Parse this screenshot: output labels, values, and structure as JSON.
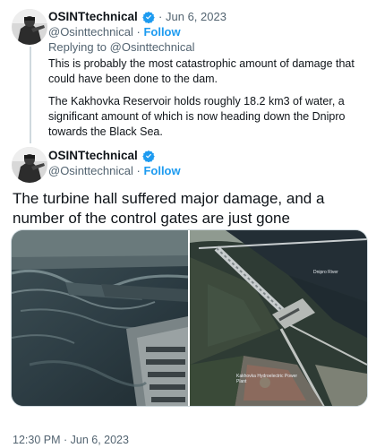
{
  "first_tweet": {
    "display_name": "OSINTtechnical",
    "separator": "·",
    "date": "Jun 6, 2023",
    "handle": "@Osinttechnical",
    "follow_label": "Follow",
    "replying_prefix": "Replying to",
    "replying_handle": "@Osinttechnical",
    "paragraph_1": "This is probably the most catastrophic amount of damage that could have been done to the dam.",
    "paragraph_2": "The Kakhovka Reservoir holds roughly 18.2 km3 of water, a significant amount of which is now heading down the Dnipro towards the Black Sea."
  },
  "second_tweet": {
    "display_name": "OSINTtechnical",
    "handle": "@Osinttechnical",
    "separator": "·",
    "follow_label": "Follow",
    "text": "The turbine hall suffered major damage, and a number of the control gates are just gone",
    "map_label_river": "Dnipro River",
    "map_label_plant": "Kakhovka Hydroelectric Power Plant",
    "timestamp": "12:30 PM · Jun 6, 2023"
  },
  "icons": {
    "verified": "verified-badge-icon",
    "avatar": "avatar-image"
  },
  "colors": {
    "link_blue": "#1d9bf0",
    "muted_gray": "#536471",
    "text": "#0f1419"
  }
}
